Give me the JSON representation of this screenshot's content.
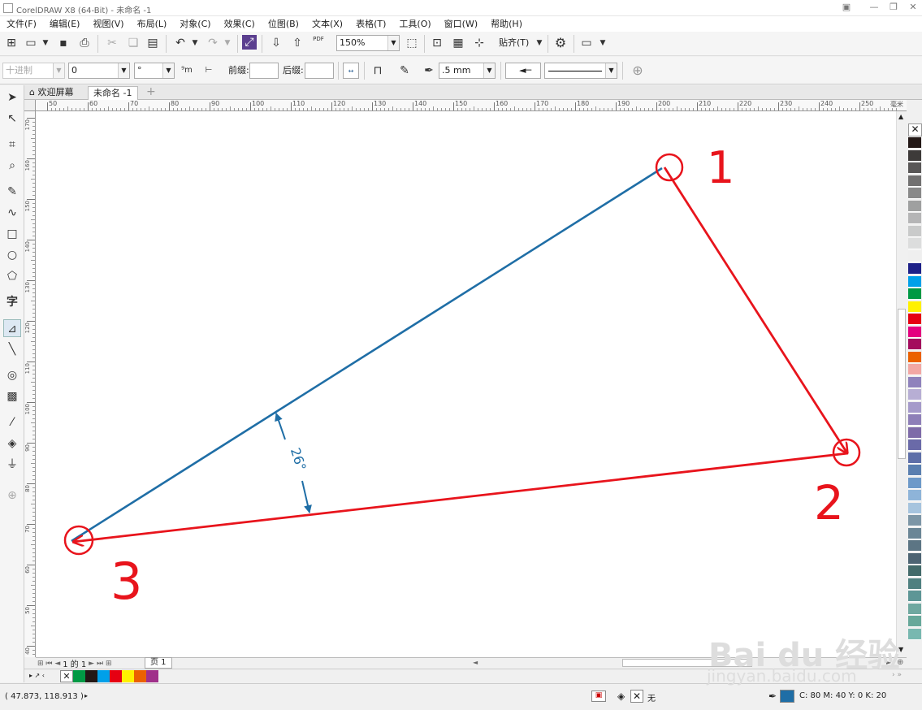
{
  "window": {
    "title": "CorelDRAW X8 (64-Bit) - 未命名 -1"
  },
  "menu": [
    "文件(F)",
    "编辑(E)",
    "视图(V)",
    "布局(L)",
    "对象(C)",
    "效果(C)",
    "位图(B)",
    "文本(X)",
    "表格(T)",
    "工具(O)",
    "窗口(W)",
    "帮助(H)"
  ],
  "toolbar": {
    "zoom": "150%",
    "snap_label": "贴齐(T)",
    "pdf_label": "PDF"
  },
  "propbar": {
    "units_select": "十进制",
    "precision_select": "0",
    "degree_symbol": "°",
    "prefix_label": "前缀:",
    "prefix_value": "",
    "suffix_label": "后缀:",
    "suffix_value": "",
    "outline_width": ".5 mm"
  },
  "tabs": {
    "welcome": "欢迎屏幕",
    "document": "未命名 -1"
  },
  "ruler": {
    "h_ticks": [
      "50",
      "60",
      "70",
      "80",
      "90",
      "100",
      "110",
      "120",
      "130",
      "140",
      "150",
      "160",
      "170",
      "180",
      "190",
      "200",
      "210",
      "220",
      "230",
      "240",
      "250"
    ],
    "h_unit": "毫米",
    "v_ticks": [
      "170",
      "160",
      "150",
      "140",
      "130",
      "120",
      "110",
      "100",
      "90",
      "80",
      "70",
      "60",
      "50",
      "40",
      "30"
    ]
  },
  "drawing": {
    "angle_label": "26°",
    "annotations": [
      "1",
      "2",
      "3"
    ],
    "colors": {
      "blue_line": "#1f6ea6",
      "red_line": "#e8141c"
    }
  },
  "pagebar": {
    "page_counter": "1 的 1",
    "page_tab": "页 1"
  },
  "status": {
    "coords": "( 47.873, 118.913 )",
    "fill_label": "无",
    "outline_color_text": "C: 80 M: 40 Y: 0 K: 20",
    "outline_color": "#1f6ea6"
  },
  "palette": [
    "#231816",
    "#3d3a39",
    "#595757",
    "#727171",
    "#898989",
    "#9fa0a0",
    "#b5b5b6",
    "#c9caca",
    "#dcdddd",
    "#efefef",
    "#1d2088",
    "#00a0e9",
    "#009944",
    "#fff100",
    "#e60012",
    "#e4007f",
    "#a40b5d",
    "#eb6100",
    "#f2a7a4",
    "#8f82bc",
    "#b7aed4",
    "#a59aca",
    "#8e7fb8",
    "#7e6ba8",
    "#6a6aa8",
    "#5e6fa8",
    "#5a7fb0",
    "#6d99c9",
    "#8eb4d9",
    "#a6c4de",
    "#7d96a6",
    "#6b8696",
    "#5c7584",
    "#4d6473",
    "#436a6a",
    "#4f8080",
    "#5d9696",
    "#6fa8a0",
    "#67a89a",
    "#78b8b0"
  ],
  "doc_palette": [
    "#009944",
    "#231816",
    "#00a0e9",
    "#e60012",
    "#fff100",
    "#eb6100",
    "#a0308a"
  ]
}
